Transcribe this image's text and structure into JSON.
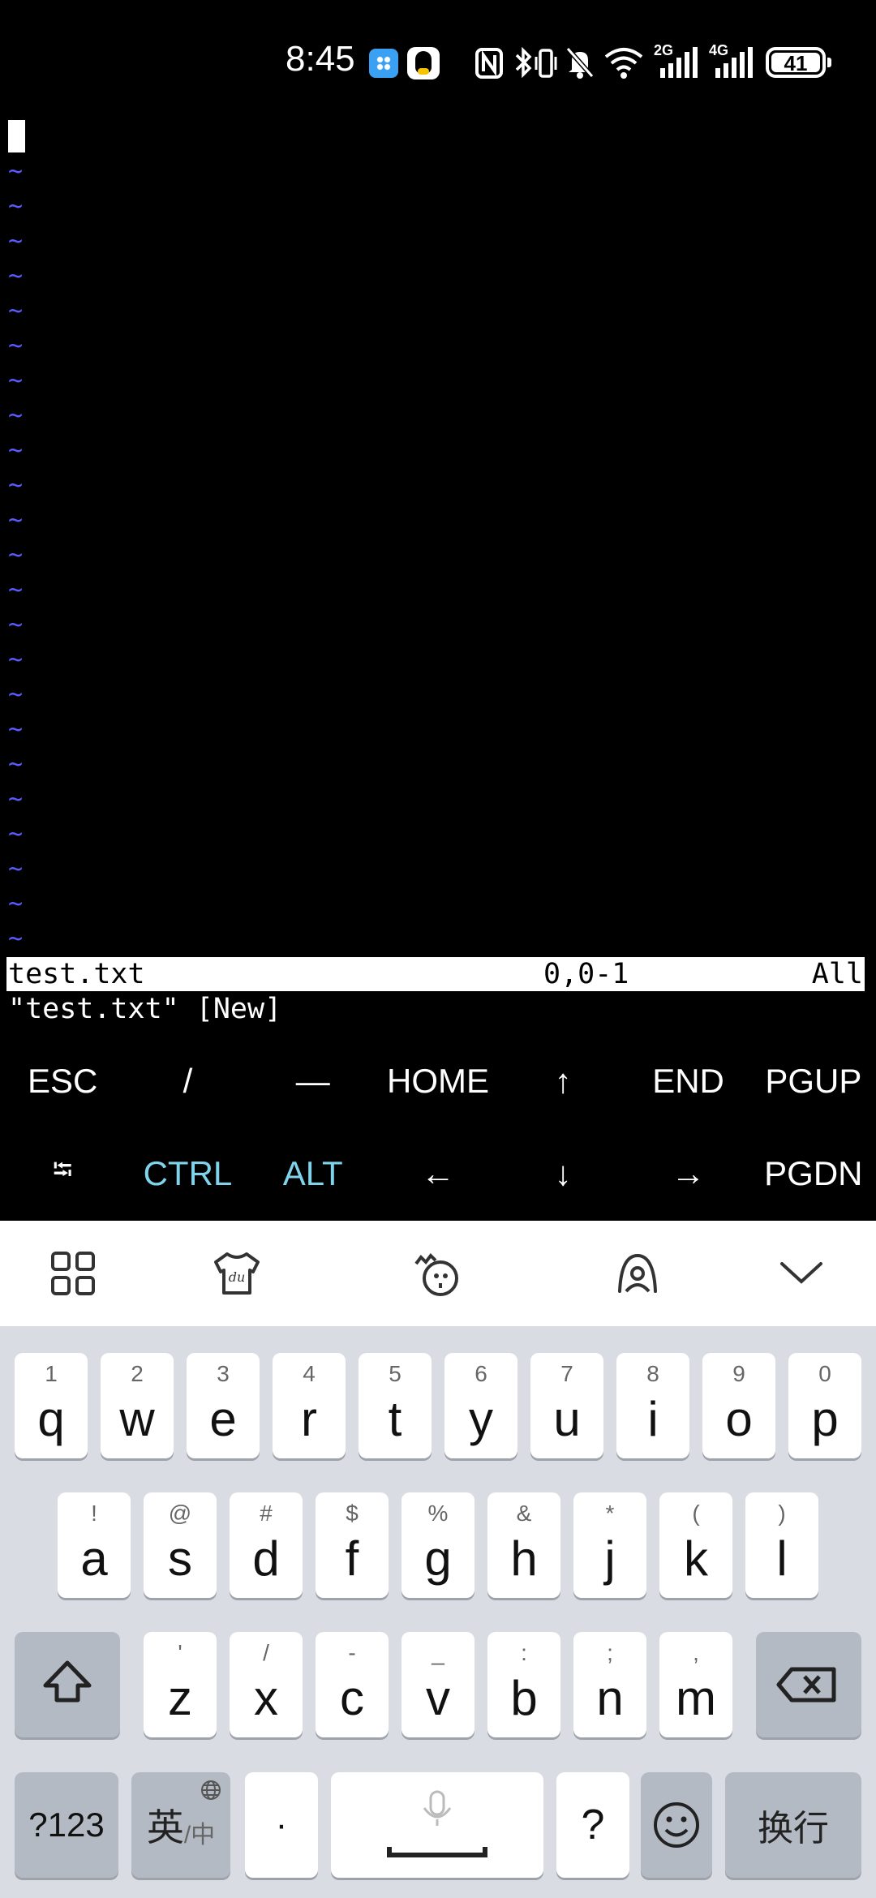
{
  "status_bar": {
    "time": "8:45",
    "network_2g": "2G",
    "network_4g": "4G",
    "battery": "41",
    "icons": [
      "app-grid-icon",
      "qq-icon",
      "nfc-icon",
      "bluetooth-icon",
      "vibrate-icon",
      "mute-icon",
      "wifi-icon",
      "signal-2g-icon",
      "signal-4g-icon",
      "battery-icon"
    ]
  },
  "terminal": {
    "tilde": "~",
    "tilde_count": 24,
    "statusline": {
      "filename": "test.txt",
      "position": "0,0-1",
      "scroll": "All"
    },
    "message": "\"test.txt\" [New]"
  },
  "extra_keys": {
    "row1": [
      "ESC",
      "/",
      "—",
      "HOME",
      "↑",
      "END",
      "PGUP"
    ],
    "row2": [
      "⭾",
      "CTRL",
      "ALT",
      "←",
      "↓",
      "→",
      "PGDN"
    ]
  },
  "keyboard": {
    "toolbar": [
      "grid-menu-icon",
      "skin-icon",
      "emoji-face-icon",
      "handwriting-icon",
      "collapse-chevron-icon"
    ],
    "row1": [
      {
        "main": "q",
        "sub": "1"
      },
      {
        "main": "w",
        "sub": "2"
      },
      {
        "main": "e",
        "sub": "3"
      },
      {
        "main": "r",
        "sub": "4"
      },
      {
        "main": "t",
        "sub": "5"
      },
      {
        "main": "y",
        "sub": "6"
      },
      {
        "main": "u",
        "sub": "7"
      },
      {
        "main": "i",
        "sub": "8"
      },
      {
        "main": "o",
        "sub": "9"
      },
      {
        "main": "p",
        "sub": "0"
      }
    ],
    "row2": [
      {
        "main": "a",
        "sub": "!"
      },
      {
        "main": "s",
        "sub": "@"
      },
      {
        "main": "d",
        "sub": "#"
      },
      {
        "main": "f",
        "sub": "$"
      },
      {
        "main": "g",
        "sub": "%"
      },
      {
        "main": "h",
        "sub": "&"
      },
      {
        "main": "j",
        "sub": "*"
      },
      {
        "main": "k",
        "sub": "("
      },
      {
        "main": "l",
        "sub": ")"
      }
    ],
    "row3": [
      {
        "main": "z",
        "sub": "'"
      },
      {
        "main": "x",
        "sub": "/"
      },
      {
        "main": "c",
        "sub": "-"
      },
      {
        "main": "v",
        "sub": "_"
      },
      {
        "main": "b",
        "sub": ":"
      },
      {
        "main": "n",
        "sub": ";"
      },
      {
        "main": "m",
        "sub": ","
      }
    ],
    "symbols_key": "?123",
    "lang_key_main": "英",
    "lang_key_sub": "/中",
    "dot_key": "·",
    "question_key": "?",
    "enter_key": "换行"
  }
}
